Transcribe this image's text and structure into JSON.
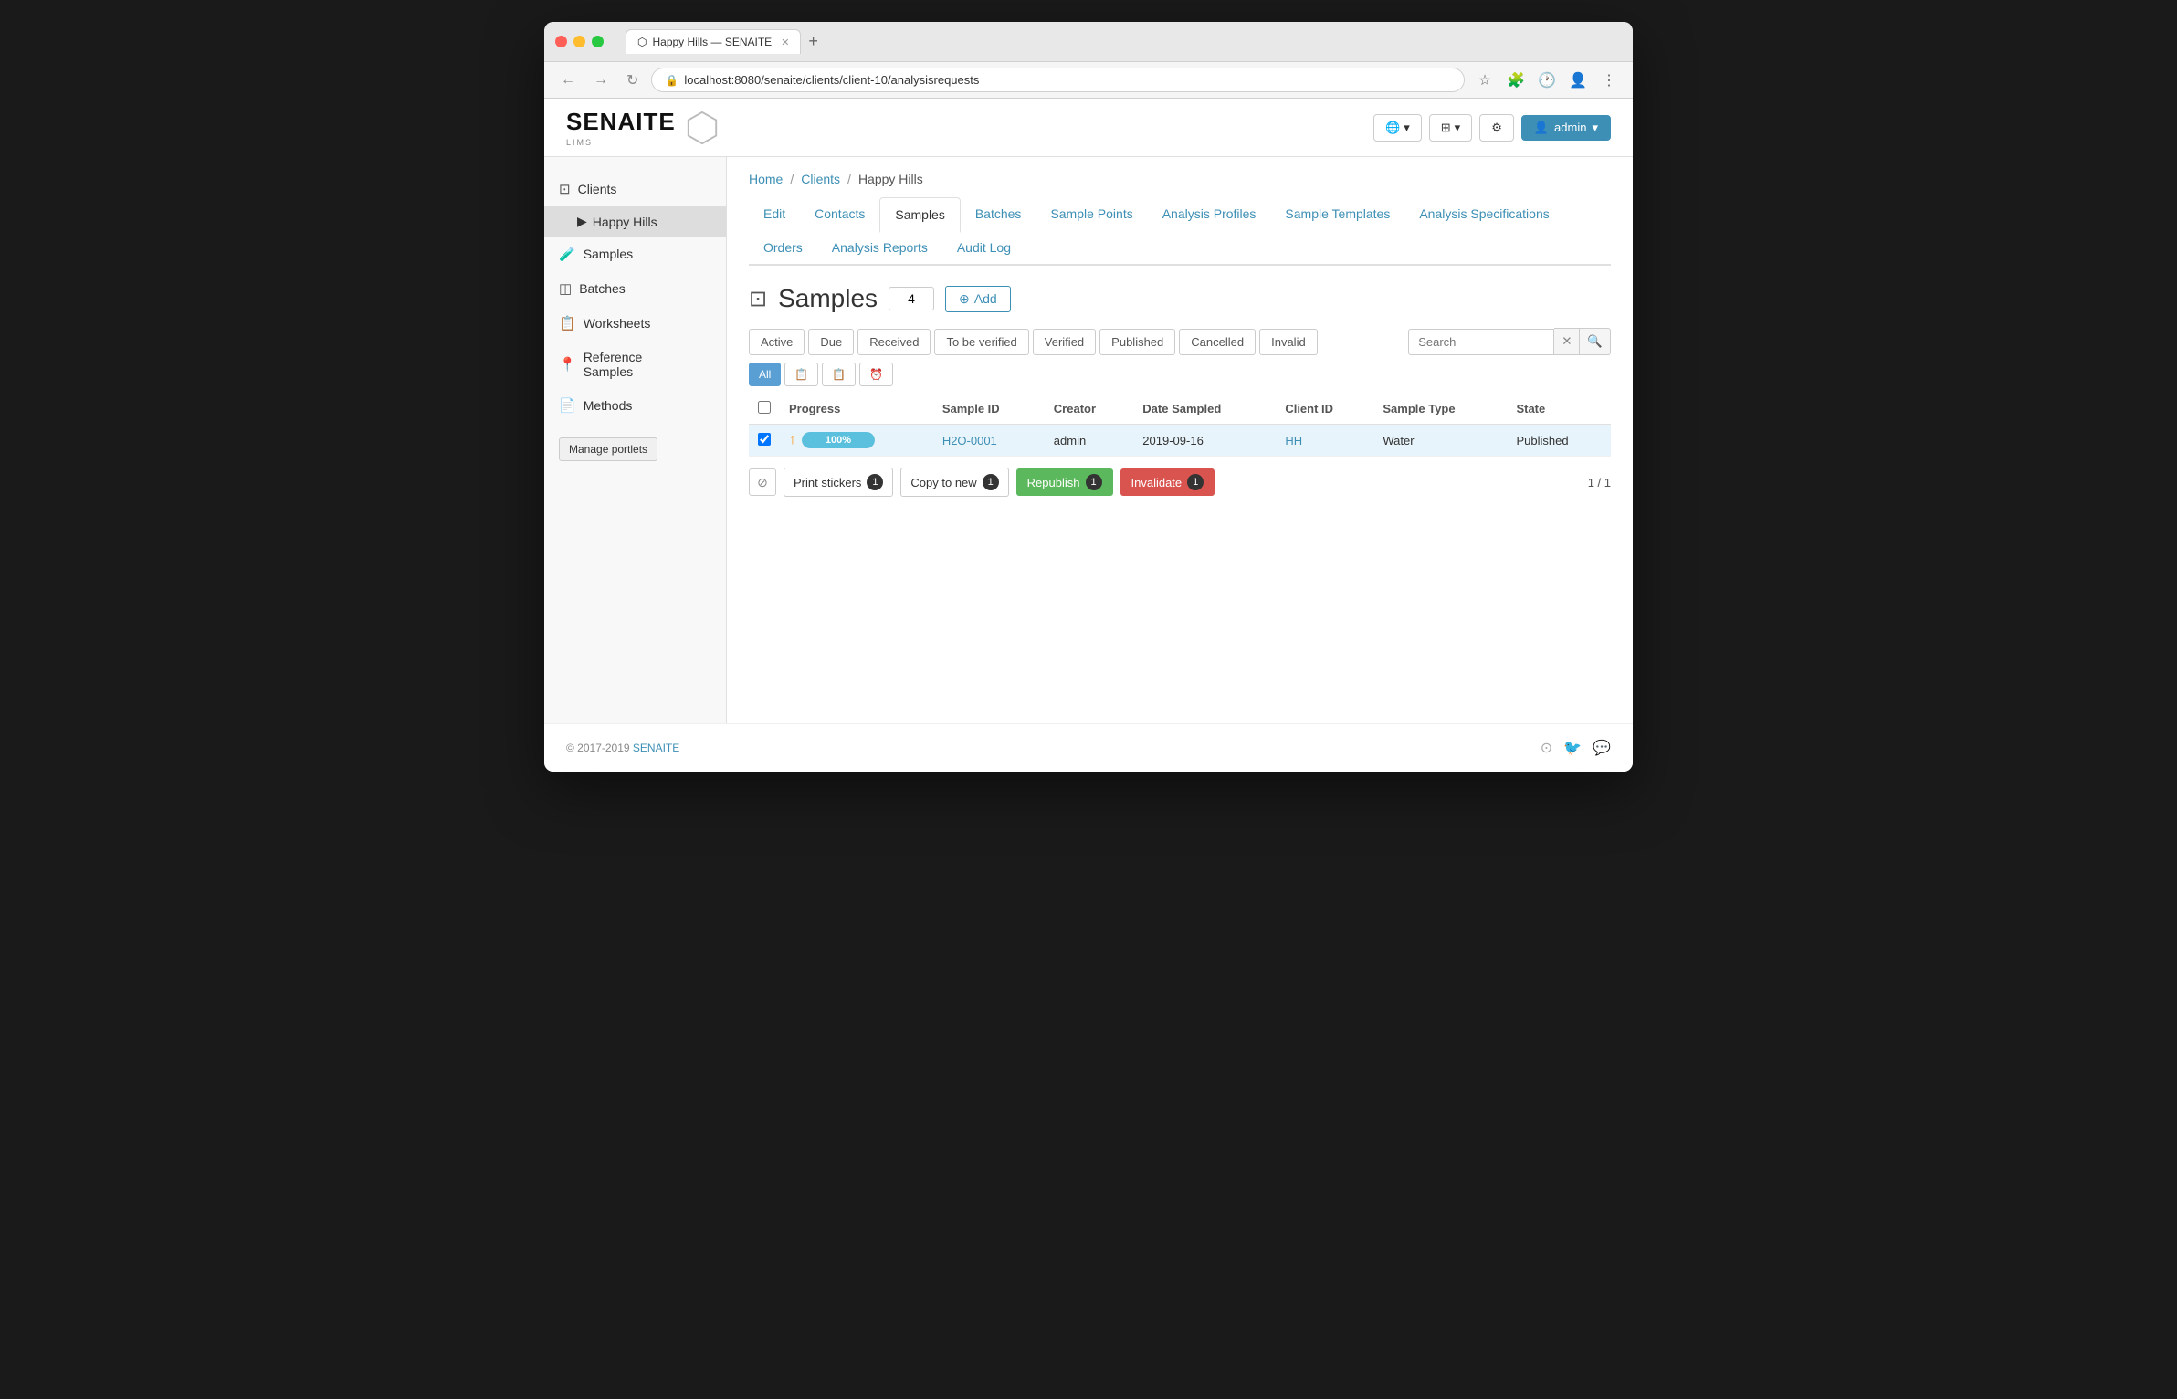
{
  "browser": {
    "tab_title": "Happy Hills — SENAITE",
    "url": "localhost:8080/senaite/clients/client-10/analysisrequests",
    "new_tab_icon": "+"
  },
  "navbar": {
    "logo_text": "SENAITE",
    "logo_sub": "LIMS",
    "globe_btn": "🌐",
    "grid_btn": "⊞",
    "settings_btn": "⚙",
    "user_label": "admin"
  },
  "sidebar": {
    "items": [
      {
        "id": "clients",
        "icon": "👥",
        "label": "Clients"
      },
      {
        "id": "happy-hills",
        "icon": "▶",
        "label": "Happy Hills"
      },
      {
        "id": "samples",
        "icon": "🧪",
        "label": "Samples"
      },
      {
        "id": "batches",
        "icon": "📦",
        "label": "Batches"
      },
      {
        "id": "worksheets",
        "icon": "📋",
        "label": "Worksheets"
      },
      {
        "id": "reference-samples",
        "icon": "📍",
        "label": "Reference Samples"
      },
      {
        "id": "methods",
        "icon": "📄",
        "label": "Methods"
      }
    ],
    "manage_portlets": "Manage portlets"
  },
  "breadcrumb": {
    "home": "Home",
    "clients": "Clients",
    "current": "Happy Hills"
  },
  "tabs": [
    {
      "id": "edit",
      "label": "Edit",
      "active": false
    },
    {
      "id": "contacts",
      "label": "Contacts",
      "active": false
    },
    {
      "id": "samples",
      "label": "Samples",
      "active": true
    },
    {
      "id": "batches",
      "label": "Batches",
      "active": false
    },
    {
      "id": "sample-points",
      "label": "Sample Points",
      "active": false
    },
    {
      "id": "analysis-profiles",
      "label": "Analysis Profiles",
      "active": false
    },
    {
      "id": "sample-templates",
      "label": "Sample Templates",
      "active": false
    },
    {
      "id": "analysis-specifications",
      "label": "Analysis Specifications",
      "active": false
    },
    {
      "id": "orders",
      "label": "Orders",
      "active": false
    },
    {
      "id": "analysis-reports",
      "label": "Analysis Reports",
      "active": false
    },
    {
      "id": "audit-log",
      "label": "Audit Log",
      "active": false
    }
  ],
  "samples_section": {
    "title": "Samples",
    "count": "4",
    "add_label": "Add",
    "filters": [
      {
        "id": "active",
        "label": "Active"
      },
      {
        "id": "due",
        "label": "Due"
      },
      {
        "id": "received",
        "label": "Received"
      },
      {
        "id": "to-be-verified",
        "label": "To be verified"
      },
      {
        "id": "verified",
        "label": "Verified"
      },
      {
        "id": "published",
        "label": "Published"
      },
      {
        "id": "cancelled",
        "label": "Cancelled"
      },
      {
        "id": "invalid",
        "label": "Invalid"
      }
    ],
    "search_placeholder": "Search",
    "action_buttons": [
      {
        "id": "all",
        "label": "All",
        "active": true
      },
      {
        "id": "copy-clipboard",
        "label": "📋",
        "active": false
      },
      {
        "id": "paste-clipboard",
        "label": "📋",
        "active": false
      },
      {
        "id": "clock",
        "label": "⏰",
        "active": false
      }
    ],
    "table": {
      "columns": [
        "",
        "Progress",
        "Sample ID",
        "Creator",
        "Date Sampled",
        "Client ID",
        "Sample Type",
        "State"
      ],
      "rows": [
        {
          "checked": true,
          "progress": 100,
          "progress_label": "100%",
          "sample_id": "H2O-0001",
          "creator": "admin",
          "date_sampled": "2019-09-16",
          "client_id": "HH",
          "sample_type": "Water",
          "state": "Published",
          "selected": true
        }
      ]
    },
    "bottom_actions": {
      "deselect_icon": "⊘",
      "print_stickers": "Print stickers",
      "copy_to_new": "Copy to new",
      "republish": "Republish",
      "invalidate": "Invalidate",
      "badge_count": "1",
      "page_count": "1 / 1"
    }
  },
  "footer": {
    "copyright": "© 2017-2019",
    "brand": "SENAITE"
  }
}
